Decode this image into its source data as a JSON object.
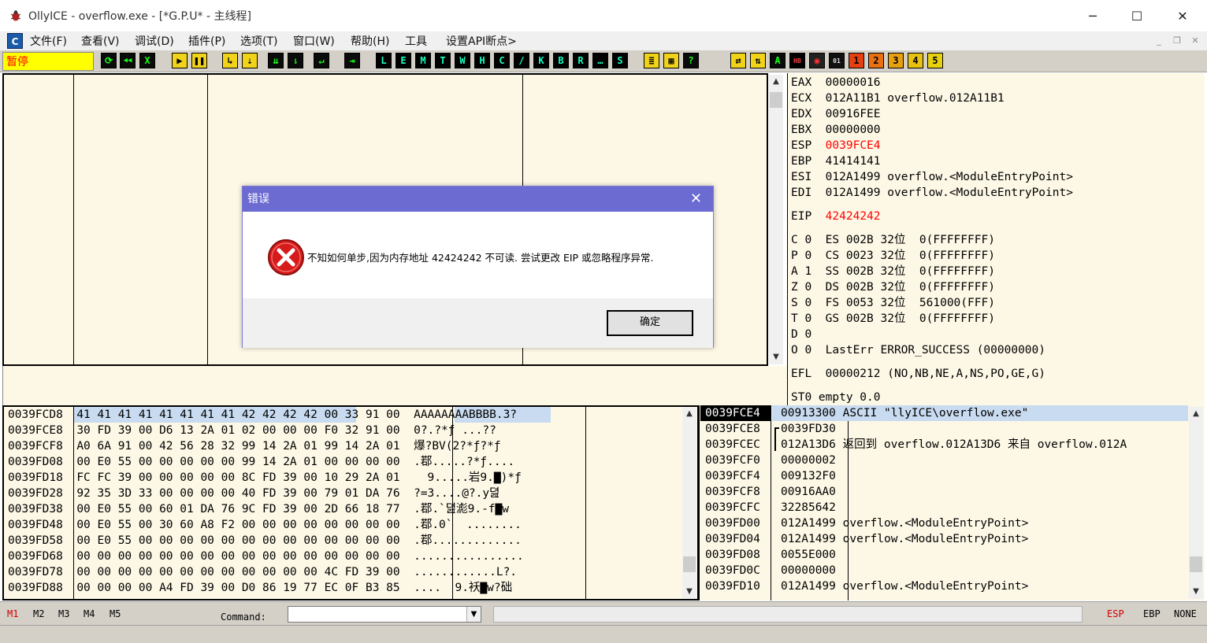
{
  "window": {
    "title": "OllyICE - overflow.exe - [*G.P.U* -  主线程]",
    "minimize": "─",
    "maximize": "☐",
    "close": "✕"
  },
  "menu": {
    "app_icon": "C",
    "items": [
      "文件(F)",
      "查看(V)",
      "调试(D)",
      "插件(P)",
      "选项(T)",
      "窗口(W)",
      "帮助(H)",
      "工具",
      "设置API断点>"
    ],
    "mdi_min": "_",
    "mdi_restore": "❐",
    "mdi_close": "✕"
  },
  "toolbar": {
    "status": "暂停",
    "buttons": [
      "⟳",
      "◀◀",
      "X",
      "▶",
      "❚❚",
      "↳",
      "⇣",
      "⇊",
      "⇂",
      "↵",
      "⇥",
      "L",
      "E",
      "M",
      "T",
      "W",
      "H",
      "C",
      "/",
      "K",
      "B",
      "R",
      "…",
      "S",
      "≣",
      "▦",
      "?",
      "⇄",
      "⇅",
      "A",
      "HB",
      "◉",
      "01",
      "1",
      "2",
      "3",
      "4",
      "5"
    ]
  },
  "registers": {
    "general": [
      {
        "name": "EAX",
        "value": "00000016",
        "comment": ""
      },
      {
        "name": "ECX",
        "value": "012A11B1",
        "comment": "overflow.012A11B1"
      },
      {
        "name": "EDX",
        "value": "00916FEE",
        "comment": ""
      },
      {
        "name": "EBX",
        "value": "00000000",
        "comment": ""
      },
      {
        "name": "ESP",
        "value": "0039FCE4",
        "comment": "",
        "changed": true
      },
      {
        "name": "EBP",
        "value": "41414141",
        "comment": ""
      },
      {
        "name": "ESI",
        "value": "012A1499",
        "comment": "overflow.<ModuleEntryPoint>"
      },
      {
        "name": "EDI",
        "value": "012A1499",
        "comment": "overflow.<ModuleEntryPoint>"
      }
    ],
    "eip": {
      "name": "EIP",
      "value": "42424242"
    },
    "flags": [
      "C 0  ES 002B 32位  0(FFFFFFFF)",
      "P 0  CS 0023 32位  0(FFFFFFFF)",
      "A 1  SS 002B 32位  0(FFFFFFFF)",
      "Z 0  DS 002B 32位  0(FFFFFFFF)",
      "S 0  FS 0053 32位  561000(FFF)",
      "T 0  GS 002B 32位  0(FFFFFFFF)",
      "D 0",
      "O 0  LastErr ERROR_SUCCESS (00000000)"
    ],
    "efl": "EFL  00000212 (NO,NB,NE,A,NS,PO,GE,G)",
    "st0": "ST0 empty 0.0"
  },
  "dump": [
    {
      "addr": "0039FCD8",
      "hex": "41 41 41 41 41 41 41 41 42 42 42 42 00 33 91 00",
      "ascii": "AAAAAAAABBBB.3?"
    },
    {
      "addr": "0039FCE8",
      "hex": "30 FD 39 00 D6 13 2A 01 02 00 00 00 F0 32 91 00",
      "ascii": "0?.?*ƒ ...??"
    },
    {
      "addr": "0039FCF8",
      "hex": "A0 6A 91 00 42 56 28 32 99 14 2A 01 99 14 2A 01",
      "ascii": "爆?BV(2?*ƒ?*ƒ"
    },
    {
      "addr": "0039FD08",
      "hex": "00 E0 55 00 00 00 00 00 99 14 2A 01 00 00 00 00",
      "ascii": ".鄀.....?*ƒ...."
    },
    {
      "addr": "0039FD18",
      "hex": "FC FC 39 00 00 00 00 00 8C FD 39 00 10 29 2A 01",
      "ascii": "  9.....岩9.▇)*ƒ"
    },
    {
      "addr": "0039FD28",
      "hex": "92 35 3D 33 00 00 00 00 40 FD 39 00 79 01 DA 76",
      "ascii": "?=3....@?.y뎚"
    },
    {
      "addr": "0039FD38",
      "hex": "00 E0 55 00 60 01 DA 76 9C FD 39 00 2D 66 18 77",
      "ascii": ".鄀.`뎚滮9.-f▇w"
    },
    {
      "addr": "0039FD48",
      "hex": "00 E0 55 00 30 60 A8 F2 00 00 00 00 00 00 00 00",
      "ascii": ".鄀.0`  ........"
    },
    {
      "addr": "0039FD58",
      "hex": "00 E0 55 00 00 00 00 00 00 00 00 00 00 00 00 00",
      "ascii": ".鄀............."
    },
    {
      "addr": "0039FD68",
      "hex": "00 00 00 00 00 00 00 00 00 00 00 00 00 00 00 00",
      "ascii": "................"
    },
    {
      "addr": "0039FD78",
      "hex": "00 00 00 00 00 00 00 00 00 00 00 00 4C FD 39 00",
      "ascii": "............L?."
    },
    {
      "addr": "0039FD88",
      "hex": "00 00 00 00 A4 FD 39 00 D0 86 19 77 EC 0F B3 85",
      "ascii": "....  9.袄▇w?础"
    }
  ],
  "stack": [
    {
      "addr": "0039FCE4",
      "value": "00913300",
      "comment": "ASCII \"llyICE\\overflow.exe\"",
      "current": true
    },
    {
      "addr": "0039FCE8",
      "value": "0039FD30",
      "comment": ""
    },
    {
      "addr": "0039FCEC",
      "value": "012A13D6",
      "comment": "返回到 overflow.012A13D6 来自 overflow.012A"
    },
    {
      "addr": "0039FCF0",
      "value": "00000002",
      "comment": ""
    },
    {
      "addr": "0039FCF4",
      "value": "009132F0",
      "comment": ""
    },
    {
      "addr": "0039FCF8",
      "value": "00916AA0",
      "comment": ""
    },
    {
      "addr": "0039FCFC",
      "value": "32285642",
      "comment": ""
    },
    {
      "addr": "0039FD00",
      "value": "012A1499",
      "comment": "overflow.<ModuleEntryPoint>"
    },
    {
      "addr": "0039FD04",
      "value": "012A1499",
      "comment": "overflow.<ModuleEntryPoint>"
    },
    {
      "addr": "0039FD08",
      "value": "0055E000",
      "comment": ""
    },
    {
      "addr": "0039FD0C",
      "value": "00000000",
      "comment": ""
    },
    {
      "addr": "0039FD10",
      "value": "012A1499",
      "comment": "overflow.<ModuleEntryPoint>"
    }
  ],
  "dialog": {
    "title": "错误",
    "close": "✕",
    "message": "不知如何单步,因为内存地址 42424242 不可读. 尝试更改 EIP 或忽略程序异常.",
    "ok_label": "确定",
    "icon": "error-icon"
  },
  "bottombar": {
    "markers": [
      "M1",
      "M2",
      "M3",
      "M4",
      "M5"
    ],
    "command_label": "Command:",
    "command_value": "",
    "right": [
      "ESP",
      "EBP",
      "NONE"
    ]
  },
  "colors": {
    "status_bg": "#ffff00",
    "status_fg": "#ff0000",
    "dialog_title": "#6b6bd2",
    "pane_bg": "#fdf8e6",
    "highlight": "#c9dbf0"
  }
}
